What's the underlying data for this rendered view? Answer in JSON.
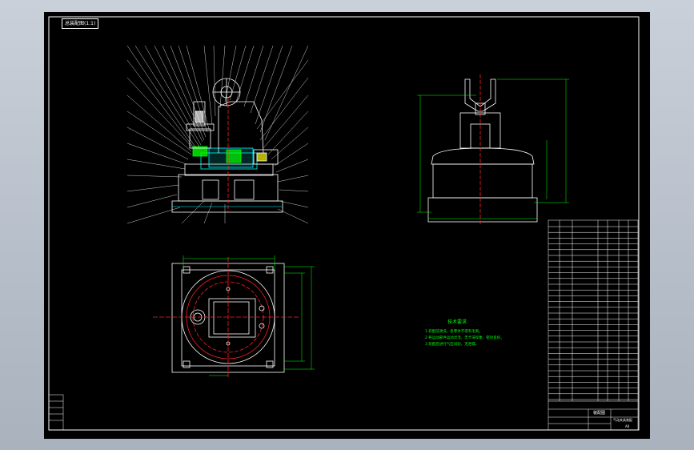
{
  "drawing_tab": "总装配图(1:1)",
  "tech_notes": {
    "title": "技术要求",
    "lines": [
      "1.装配前清洗，各零件不得有毛刺。",
      "2.各运动部件运动灵活，无卡滞现象，密封良好。",
      "3.装配后进行气压试验，无泄漏。"
    ]
  },
  "title_block": {
    "name": "装配图",
    "subtitle": "气动夹具装配",
    "sheet": "A0"
  },
  "colors": {
    "background": "#000000",
    "outline": "#ffffff",
    "dimension": "#00ff00",
    "centerline": "#ff2020",
    "leader": "#ffffff",
    "hatch": "#00ffff",
    "accent": "#ffff00"
  }
}
